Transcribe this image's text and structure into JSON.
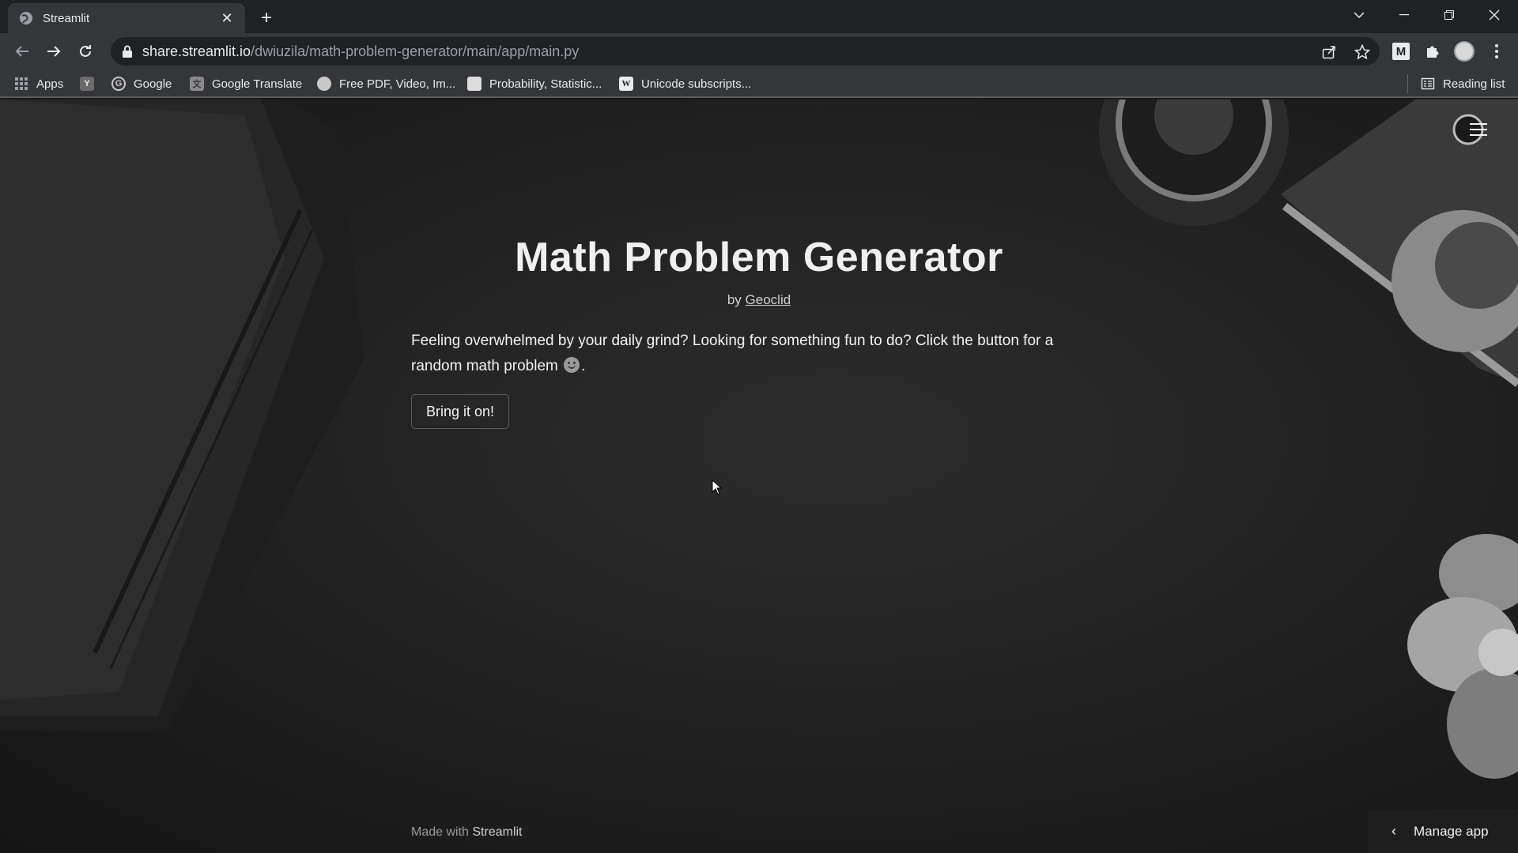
{
  "browser": {
    "tab_title": "Streamlit",
    "url_host": "share.streamlit.io",
    "url_path": "/dwiuzila/math-problem-generator/main/app/main.py",
    "bookmarks": [
      {
        "label": "Apps",
        "icon": "apps-grid-icon"
      },
      {
        "label": "",
        "icon": "bookmark-y-icon"
      },
      {
        "label": "Google",
        "icon": "google-icon"
      },
      {
        "label": "Google Translate",
        "icon": "translate-icon"
      },
      {
        "label": "Free PDF, Video, Im...",
        "icon": "globe-icon"
      },
      {
        "label": "Probability, Statistic...",
        "icon": "page-icon"
      },
      {
        "label": "Unicode subscripts...",
        "icon": "wikipedia-icon"
      }
    ],
    "reading_list": "Reading list"
  },
  "app": {
    "title": "Math Problem Generator",
    "byline_prefix": "by",
    "author": "Geoclid",
    "description_1": "Feeling overwhelmed by your daily grind? Looking for something fun to do? Click the button for a random math problem",
    "description_end": ".",
    "emoji": "slightly-smiling-face-icon",
    "button_label": "Bring it on!"
  },
  "footer": {
    "made_with": "Made with",
    "brand": "Streamlit"
  },
  "manage_app": {
    "label": "Manage app"
  },
  "colors": {
    "chrome_dark": "#202124",
    "chrome_toolbar": "#35363a",
    "page_bg": "#1b1b1b",
    "text_primary": "#f0f0f0"
  }
}
